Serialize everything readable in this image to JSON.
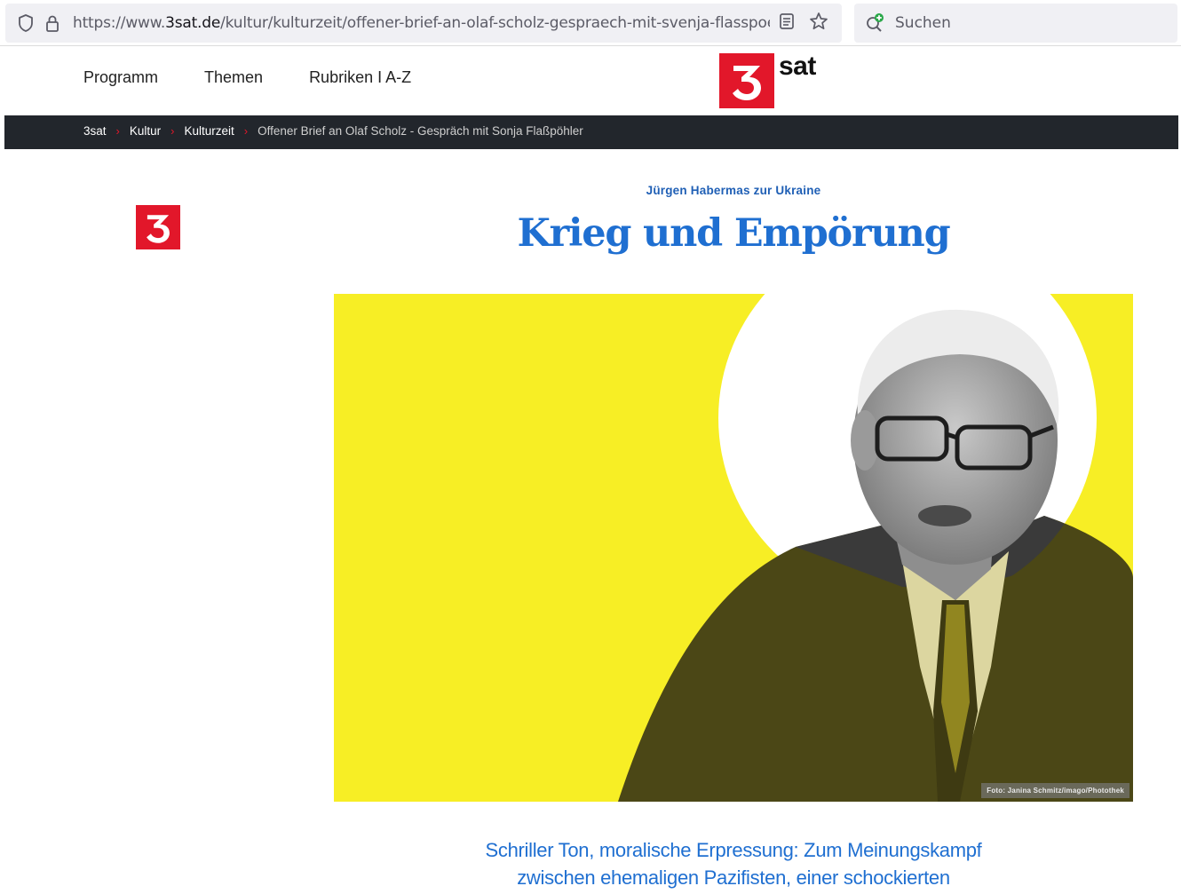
{
  "browser": {
    "url_prefix": "https://www.",
    "url_domain": "3sat.de",
    "url_path": "/kultur/kulturzeit/offener-brief-an-olaf-scholz-gespraech-mit-svenja-flasspoehler",
    "search_placeholder": "Suchen",
    "icons": [
      "shield-icon",
      "lock-icon",
      "reader-view-icon",
      "bookmark-star-icon",
      "search-add-icon"
    ]
  },
  "header": {
    "nav": [
      "Programm",
      "Themen",
      "Rubriken I A-Z"
    ],
    "logo_text": "sat",
    "logo_digit": "3"
  },
  "breadcrumb": {
    "items": [
      "3sat",
      "Kultur",
      "Kulturzeit"
    ],
    "current": "Offener Brief an Olaf Scholz - Gespräch mit Sonja Flaßpöhler"
  },
  "article": {
    "kicker": "Jürgen Habermas zur Ukraine",
    "headline": "Krieg und Empörung",
    "image_caption": "Foto: Janina Schmitz/imago/Photothek",
    "lead_line1": "Schriller Ton, moralische Erpressung: Zum Meinungskampf",
    "lead_line2": "zwischen ehemaligen Pazifisten, einer schockierten"
  },
  "colors": {
    "brand_red": "#e2172a",
    "headline_blue": "#1f6fd1",
    "hero_yellow": "#f7ee25",
    "breadcrumb_bg": "#22262c"
  }
}
